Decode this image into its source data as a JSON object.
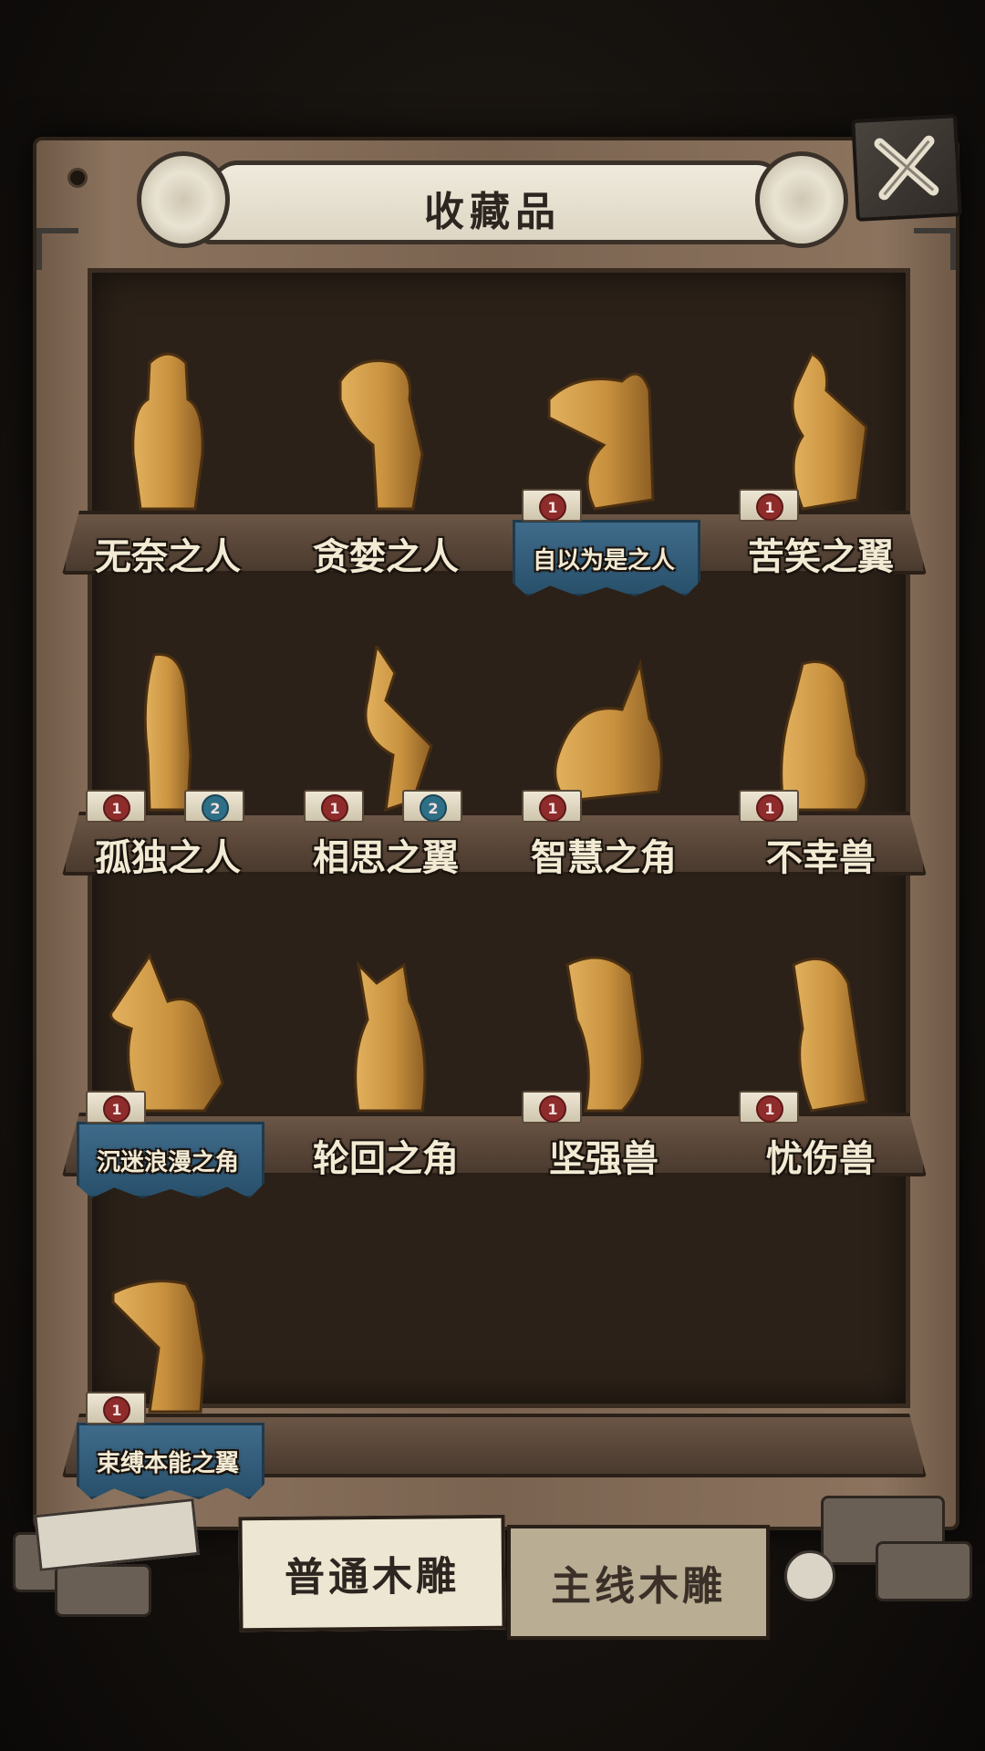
{
  "header": {
    "title": "收藏品"
  },
  "tabs": [
    {
      "label": "普通木雕",
      "active": true
    },
    {
      "label": "主线木雕",
      "active": false
    }
  ],
  "colors": {
    "badge_red": "#8e2b2b",
    "badge_blue": "#2f6f86",
    "highlight_plate": "#3f6b8a"
  },
  "items": [
    {
      "name": "无奈之人",
      "highlight": false,
      "badges": []
    },
    {
      "name": "贪婪之人",
      "highlight": false,
      "badges": []
    },
    {
      "name": "自以为是之人",
      "highlight": true,
      "badges": [
        {
          "label": "1",
          "color": "red"
        }
      ]
    },
    {
      "name": "苦笑之翼",
      "highlight": false,
      "badges": [
        {
          "label": "1",
          "color": "red"
        }
      ]
    },
    {
      "name": "孤独之人",
      "highlight": false,
      "badges": [
        {
          "label": "1",
          "color": "red"
        },
        {
          "label": "2",
          "color": "blue"
        }
      ]
    },
    {
      "name": "相思之翼",
      "highlight": false,
      "badges": [
        {
          "label": "1",
          "color": "red"
        },
        {
          "label": "2",
          "color": "blue"
        }
      ]
    },
    {
      "name": "智慧之角",
      "highlight": false,
      "badges": [
        {
          "label": "1",
          "color": "red"
        }
      ]
    },
    {
      "name": "不幸兽",
      "highlight": false,
      "badges": [
        {
          "label": "1",
          "color": "red"
        }
      ]
    },
    {
      "name": "沉迷浪漫之角",
      "highlight": true,
      "badges": [
        {
          "label": "1",
          "color": "red"
        }
      ]
    },
    {
      "name": "轮回之角",
      "highlight": false,
      "badges": []
    },
    {
      "name": "坚强兽",
      "highlight": false,
      "badges": [
        {
          "label": "1",
          "color": "red"
        }
      ]
    },
    {
      "name": "忧伤兽",
      "highlight": false,
      "badges": [
        {
          "label": "1",
          "color": "red"
        }
      ]
    },
    {
      "name": "束缚本能之翼",
      "highlight": true,
      "badges": [
        {
          "label": "1",
          "color": "red"
        }
      ]
    }
  ]
}
